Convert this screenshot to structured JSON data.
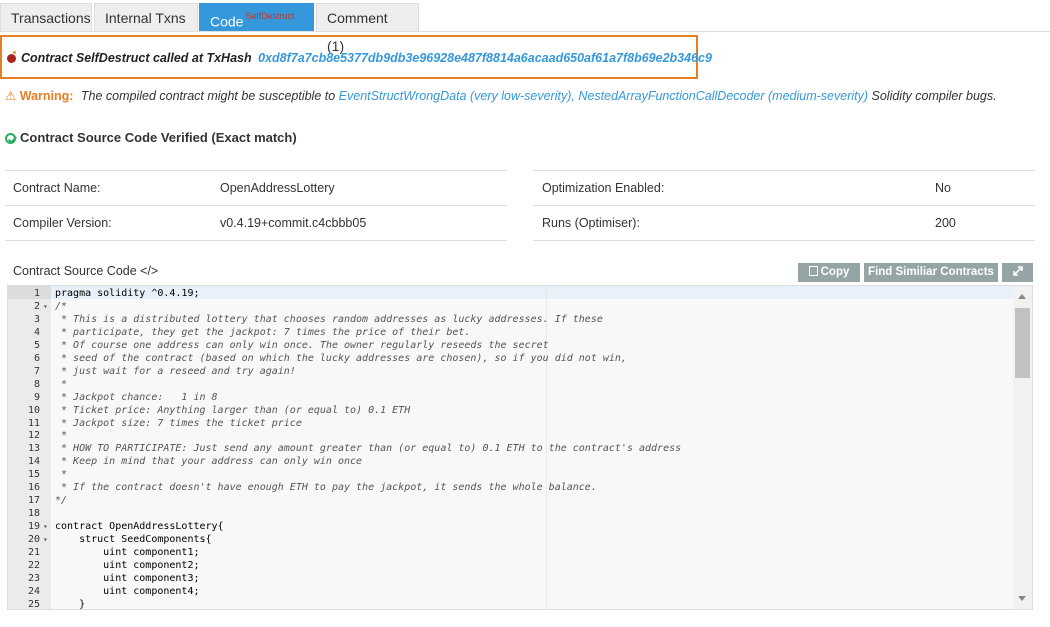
{
  "tabs": [
    {
      "label": "Transactions"
    },
    {
      "label": "Internal Txns"
    },
    {
      "label": "Code",
      "badge": "SelfDestruct"
    },
    {
      "label": "Comment (1)"
    }
  ],
  "self_destruct": {
    "text": "Contract SelfDestruct called at TxHash",
    "hash": "0xd8f7a7cb8e5377db9db3e96928e487f8814a6acaad650af61a7f8b69e2b346c9"
  },
  "warning": {
    "label": "Warning:",
    "text_pre": "The compiled contract might be susceptible to",
    "link1": "EventStructWrongData (very low-severity),",
    "link2": "NestedArrayFunctionCallDecoder (medium-severity)",
    "text_post": "Solidity compiler bugs."
  },
  "verified": {
    "text": "Contract Source Code Verified (Exact match)"
  },
  "info": {
    "contract_name_label": "Contract Name:",
    "contract_name": "OpenAddressLottery",
    "compiler_label": "Compiler Version:",
    "compiler": "v0.4.19+commit.c4cbbb05",
    "optimization_label": "Optimization Enabled:",
    "optimization": "No",
    "runs_label": "Runs (Optimiser):",
    "runs": "200"
  },
  "source": {
    "title": "Contract Source Code </>",
    "copy_label": "Copy",
    "find_label": "Find Similiar Contracts",
    "expand_icon": "expand-icon"
  },
  "code_lines": [
    "pragma solidity ^0.4.19;",
    "/*",
    " * This is a distributed lottery that chooses random addresses as lucky addresses. If these",
    " * participate, they get the jackpot: 7 times the price of their bet.",
    " * Of course one address can only win once. The owner regularly reseeds the secret",
    " * seed of the contract (based on which the lucky addresses are chosen), so if you did not win,",
    " * just wait for a reseed and try again!",
    " *",
    " * Jackpot chance:   1 in 8",
    " * Ticket price: Anything larger than (or equal to) 0.1 ETH",
    " * Jackpot size: 7 times the ticket price",
    " *",
    " * HOW TO PARTICIPATE: Just send any amount greater than (or equal to) 0.1 ETH to the contract's address",
    " * Keep in mind that your address can only win once",
    " *",
    " * If the contract doesn't have enough ETH to pay the jackpot, it sends the whole balance.",
    "*/",
    "",
    "contract OpenAddressLottery{",
    "    struct SeedComponents{",
    "        uint component1;",
    "        uint component2;",
    "        uint component3;",
    "        uint component4;",
    "    }"
  ],
  "line_numbers": [
    "1",
    "2",
    "3",
    "4",
    "5",
    "6",
    "7",
    "8",
    "9",
    "10",
    "11",
    "12",
    "13",
    "14",
    "15",
    "16",
    "17",
    "18",
    "19",
    "20",
    "21",
    "22",
    "23",
    "24",
    "25"
  ],
  "fold_lines": [
    2,
    19,
    20
  ],
  "colors": {
    "accent": "#3498db",
    "warning": "#e67e22",
    "success": "#27ae60",
    "button": "#95a5a6"
  }
}
